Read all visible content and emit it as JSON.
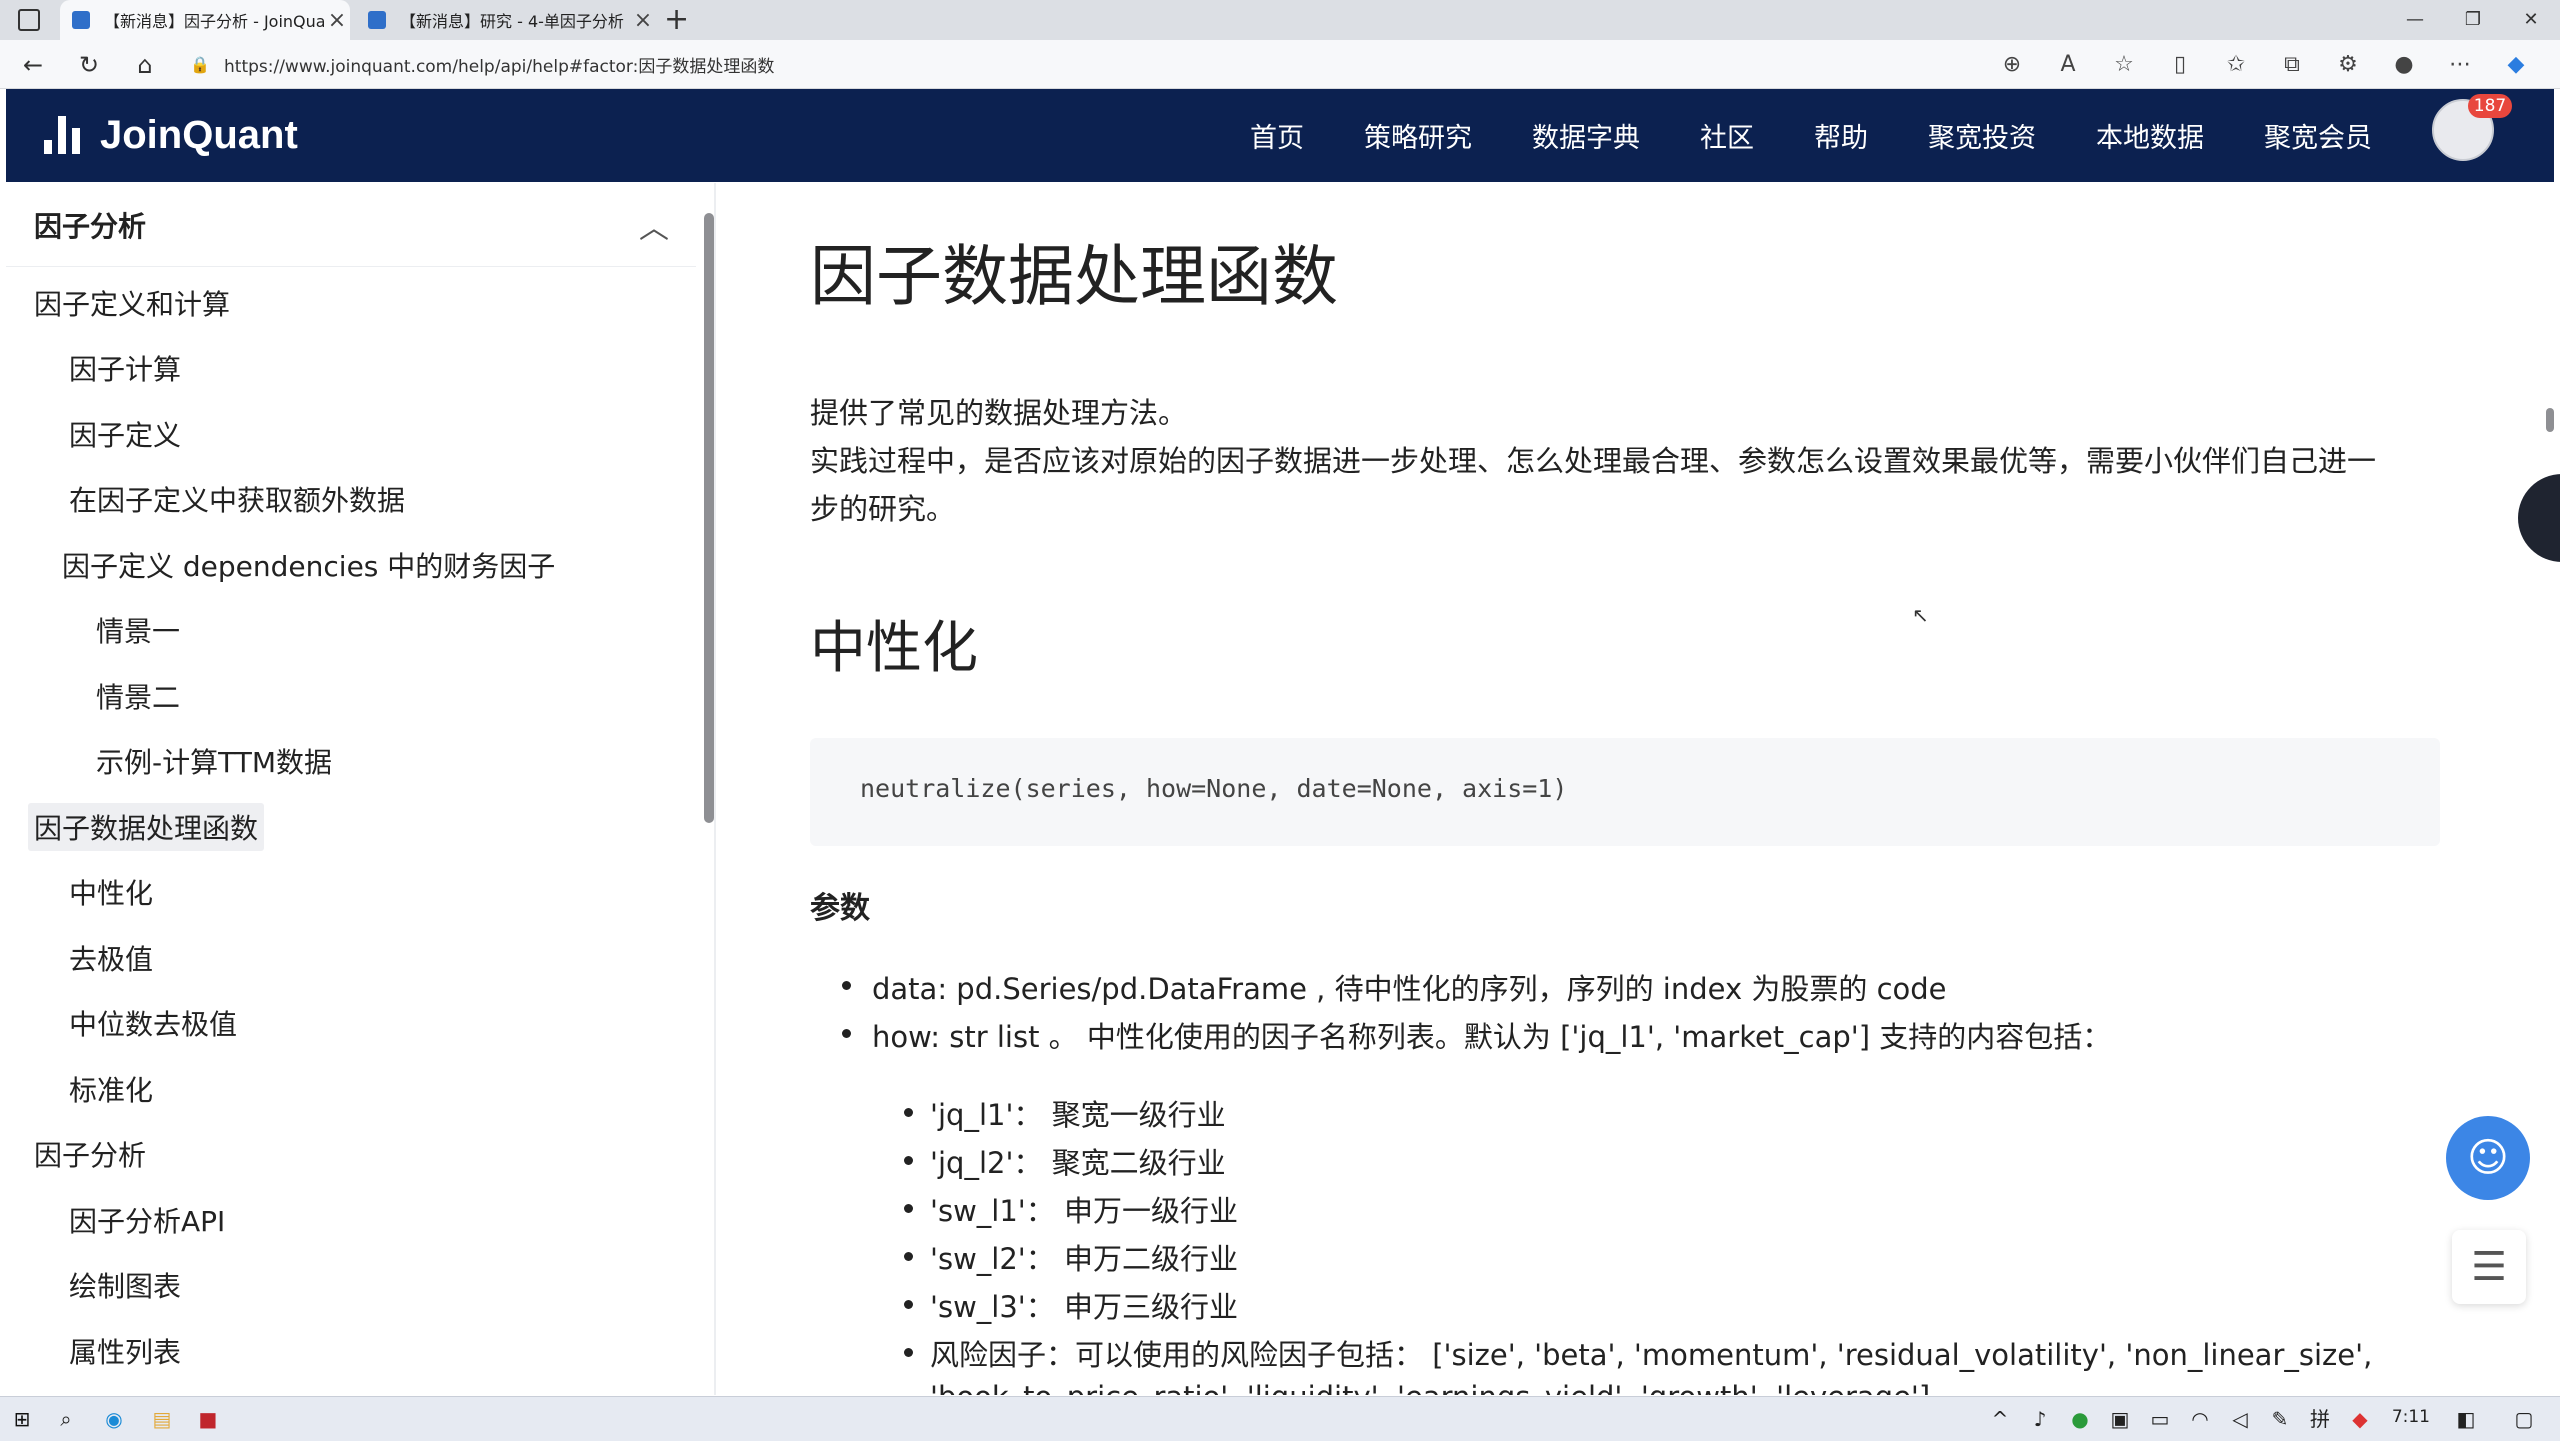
{
  "browser": {
    "tabs": [
      {
        "title": "【新消息】因子分析 - JoinQuant",
        "active": true
      },
      {
        "title": "【新消息】研究 - 4-单因子分析",
        "active": false
      }
    ],
    "new_tab": "+",
    "url": "https://www.joinquant.com/help/api/help#factor:因子数据处理函数"
  },
  "site": {
    "logo_text": "JoinQuant",
    "nav": [
      "首页",
      "策略研究",
      "数据字典",
      "社区",
      "帮助",
      "聚宽投资",
      "本地数据",
      "聚宽会员"
    ],
    "notification_count": "187"
  },
  "sidebar": {
    "title": "因子分析",
    "items": [
      {
        "label": "因子定义和计算",
        "level": 0
      },
      {
        "label": "因子计算",
        "level": 1
      },
      {
        "label": "因子定义",
        "level": 1
      },
      {
        "label": "在因子定义中获取额外数据",
        "level": 1
      },
      {
        "label": "因子定义 dependencies 中的财务因子",
        "level": 1
      },
      {
        "label": "情景一",
        "level": 2
      },
      {
        "label": "情景二",
        "level": 2
      },
      {
        "label": "示例-计算TTM数据",
        "level": 2
      },
      {
        "label": "因子数据处理函数",
        "level": 0,
        "selected": true
      },
      {
        "label": "中性化",
        "level": 1
      },
      {
        "label": "去极值",
        "level": 1
      },
      {
        "label": "中位数去极值",
        "level": 1
      },
      {
        "label": "标准化",
        "level": 1
      },
      {
        "label": "因子分析",
        "level": 0
      },
      {
        "label": "因子分析API",
        "level": 1
      },
      {
        "label": "绘制图表",
        "level": 1
      },
      {
        "label": "属性列表",
        "level": 1
      }
    ]
  },
  "content": {
    "h1": "因子数据处理函数",
    "intro_1": "提供了常见的数据处理方法。",
    "intro_2a": "实践过程中，是否应该对原始的因子数据进一步处理、怎么处理最合理、参数怎么设置效果最优等，需要小伙伴们自己进一",
    "intro_2b": "步的研究。",
    "h2": "中性化",
    "code": "neutralize(series, how=None, date=None, axis=1)",
    "params_heading": "参数",
    "params": [
      "data: pd.Series/pd.DataFrame , 待中性化的序列，序列的 index 为股票的 code",
      "how: str list 。 中性化使用的因子名称列表。默认为 ['jq_l1', 'market_cap'] 支持的内容包括："
    ],
    "how_options": [
      "'jq_l1'：  聚宽一级行业",
      "'jq_l2'：  聚宽二级行业",
      "'sw_l1'：  申万一级行业",
      "'sw_l2'：  申万二级行业",
      "'sw_l3'：  申万三级行业",
      "风险因子：可以使用的风险因子包括：  ['size', 'beta', 'momentum', 'residual_volatility', 'non_linear_size',"
    ],
    "how_options_cont": "'book_to_price_ratio', 'liquidity', 'earnings_yield', 'growth', 'leverage']"
  },
  "taskbar": {
    "clock": "7:11"
  }
}
